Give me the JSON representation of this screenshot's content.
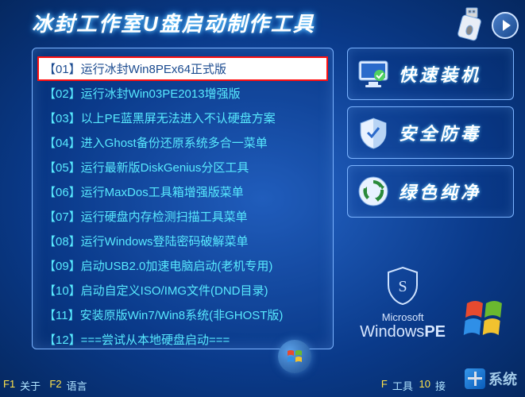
{
  "title": "冰封工作室U盘启动制作工具",
  "menu": {
    "items": [
      "【01】运行冰封Win8PEx64正式版",
      "【02】运行冰封Win03PE2013增强版",
      "【03】以上PE蓝黑屏无法进入不认硬盘方案",
      "【04】进入Ghost备份还原系统多合一菜单",
      "【05】运行最新版DiskGenius分区工具",
      "【06】运行MaxDos工具箱增强版菜单",
      "【07】运行硬盘内存检测扫描工具菜单",
      "【08】运行Windows登陆密码破解菜单",
      "【09】启动USB2.0加速电脑启动(老机专用)",
      "【10】启动自定义ISO/IMG文件(DND目录)",
      "【11】安装原版Win7/Win8系统(非GHOST版)",
      "【12】===尝试从本地硬盘启动==="
    ],
    "selected_index": 0
  },
  "side": {
    "install": "快速装机",
    "security": "安全防毒",
    "green": "绿色纯净"
  },
  "winpe": {
    "line1": "Microsoft",
    "line2_a": "Windows",
    "line2_b": "PE"
  },
  "footer": {
    "f1_key": "F1",
    "f1_label": "关于",
    "f2_key": "F2",
    "f2_label": "语言",
    "f9_key": "F",
    "f9_label": "工具",
    "f10_key": "10",
    "f10_label": "接"
  },
  "watermark": "系统"
}
